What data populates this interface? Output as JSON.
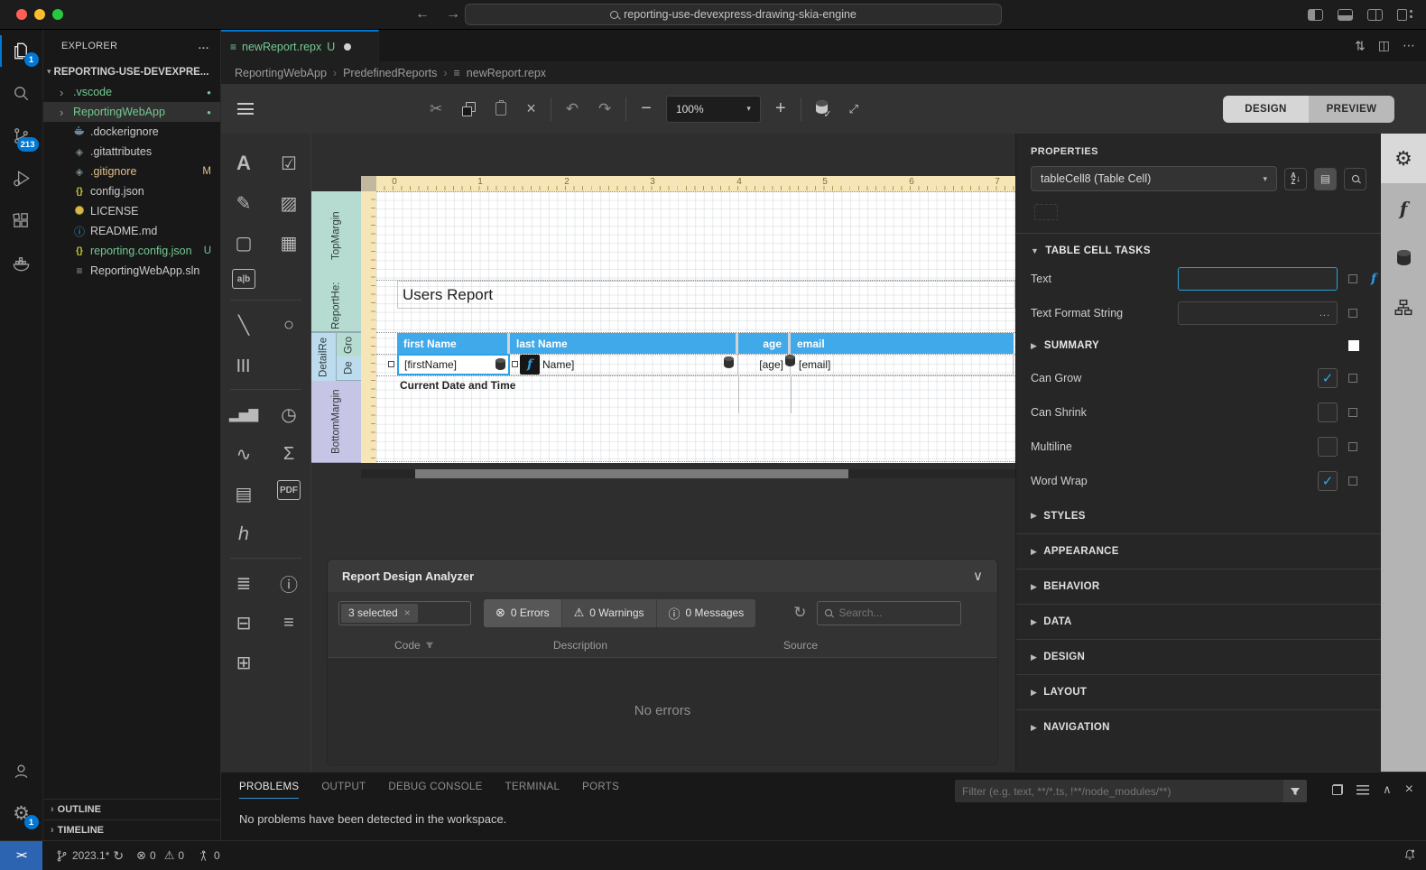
{
  "titlebar": {
    "search_value": "reporting-use-devexpress-drawing-skia-engine"
  },
  "activity_bar": {
    "explorer_badge": "1",
    "scm_badge": "213",
    "manage_badge": "1"
  },
  "sidebar": {
    "title": "EXPLORER",
    "more_label": "...",
    "root_label": "REPORTING-USE-DEVEXPRE...",
    "items": [
      {
        "label": ".vscode",
        "badge": "●",
        "type": "folder-untracked"
      },
      {
        "label": "ReportingWebApp",
        "badge": "●",
        "type": "folder-untracked-selected"
      },
      {
        "label": ".dockerignore",
        "badge": "",
        "type": "docker"
      },
      {
        "label": ".gitattributes",
        "badge": "",
        "type": "git"
      },
      {
        "label": ".gitignore",
        "badge": "M",
        "type": "git-modified"
      },
      {
        "label": "config.json",
        "badge": "",
        "type": "json"
      },
      {
        "label": "LICENSE",
        "badge": "",
        "type": "license"
      },
      {
        "label": "README.md",
        "badge": "",
        "type": "markdown"
      },
      {
        "label": "reporting.config.json",
        "badge": "U",
        "type": "json-untracked"
      },
      {
        "label": "ReportingWebApp.sln",
        "badge": "",
        "type": "solution"
      }
    ],
    "outline_label": "OUTLINE",
    "timeline_label": "TIMELINE"
  },
  "editor": {
    "tab_label": "newReport.repx",
    "tab_badge": "U",
    "breadcrumb": [
      "ReportingWebApp",
      "PredefinedReports",
      "newReport.repx"
    ]
  },
  "designer": {
    "zoom_value": "100%",
    "design_label": "DESIGN",
    "preview_label": "PREVIEW",
    "ruler": [
      "0",
      "1",
      "2",
      "3",
      "4",
      "5",
      "6",
      "7"
    ],
    "bands": {
      "top_margin": "TopMargin",
      "report_header": "ReportHe:",
      "detail_report": "DetailRe",
      "group_header": "Gro",
      "detail": "De",
      "bottom_margin": "BottomMargin"
    },
    "report": {
      "title": "Users Report",
      "header_cells": [
        "first Name",
        "last Name",
        "age",
        "email"
      ],
      "detail_cells": [
        "[firstName]",
        "Name]",
        "[age]",
        "[email]"
      ],
      "footer_text": "Current Date and Time"
    },
    "toolbox": [
      {
        "name": "label-tool",
        "glyph": "A"
      },
      {
        "name": "checkbox-tool",
        "glyph": "☑"
      },
      {
        "name": "richtext-tool",
        "glyph": "✎"
      },
      {
        "name": "picturebox-tool",
        "glyph": "▨"
      },
      {
        "name": "panel-tool",
        "glyph": "▢"
      },
      {
        "name": "table-tool",
        "glyph": "▦"
      },
      {
        "name": "character-comb-tool",
        "glyph": "a|b"
      },
      {
        "name": "line-tool",
        "glyph": "╲"
      },
      {
        "name": "shape-tool",
        "glyph": "○"
      },
      {
        "name": "barcode-tool",
        "glyph": "|||"
      },
      {
        "name": "chart-tool",
        "glyph": "▂▅▇"
      },
      {
        "name": "gauge-tool",
        "glyph": "◷"
      },
      {
        "name": "sparkline-tool",
        "glyph": "∿"
      },
      {
        "name": "summary-tool",
        "glyph": "Σ"
      },
      {
        "name": "page-info-tool",
        "glyph": "▤"
      },
      {
        "name": "pdf-content-tool",
        "glyph": "PDF"
      },
      {
        "name": "signature-tool",
        "glyph": "ℎ"
      },
      {
        "name": "toc-tool",
        "glyph": "≣"
      },
      {
        "name": "page-document-info-tool",
        "glyph": "ⓘ"
      },
      {
        "name": "page-break-tool",
        "glyph": "⊟"
      },
      {
        "name": "cross-band-line-tool",
        "glyph": "≡"
      },
      {
        "name": "cross-band-box-tool",
        "glyph": "⊞"
      }
    ]
  },
  "analyzer": {
    "title": "Report Design Analyzer",
    "selected_chip": "3 selected",
    "errors_label": "0 Errors",
    "warnings_label": "0 Warnings",
    "messages_label": "0 Messages",
    "search_placeholder": "Search...",
    "columns": [
      "Code",
      "Description",
      "Source"
    ],
    "empty_text": "No errors"
  },
  "properties": {
    "title": "PROPERTIES",
    "selector_value": "tableCell8 (Table Cell)",
    "tasks_section": "TABLE CELL TASKS",
    "text_label": "Text",
    "text_value": "",
    "format_label": "Text Format String",
    "format_value": "",
    "ellipsis": "...",
    "summary_label": "SUMMARY",
    "checkboxes": [
      {
        "label": "Can Grow",
        "checked": true
      },
      {
        "label": "Can Shrink",
        "checked": false
      },
      {
        "label": "Multiline",
        "checked": false
      },
      {
        "label": "Word Wrap",
        "checked": true
      }
    ],
    "sections": [
      "STYLES",
      "APPEARANCE",
      "BEHAVIOR",
      "DATA",
      "DESIGN",
      "LAYOUT",
      "NAVIGATION"
    ]
  },
  "bottom_panel": {
    "tabs": [
      "PROBLEMS",
      "OUTPUT",
      "DEBUG CONSOLE",
      "TERMINAL",
      "PORTS"
    ],
    "message": "No problems have been detected in the workspace.",
    "filter_placeholder": "Filter (e.g. text, **/*.ts, !**/node_modules/**)"
  },
  "statusbar": {
    "branch": "2023.1*",
    "errors": "0",
    "warnings": "0",
    "ports": "0"
  },
  "colors": {
    "accent_blue": "#0078d4",
    "table_header_blue": "#3fa9ea",
    "selection_cyan": "#2aa3e8",
    "git_untracked_green": "#73c991",
    "git_modified_yellow": "#e2c08d",
    "ruler_cream": "#f6e5b6",
    "band_teal": "#b6dcd2",
    "band_blue": "#bcdcee",
    "band_purple": "#c6c5e5",
    "remote_blue": "#2c64b1"
  }
}
